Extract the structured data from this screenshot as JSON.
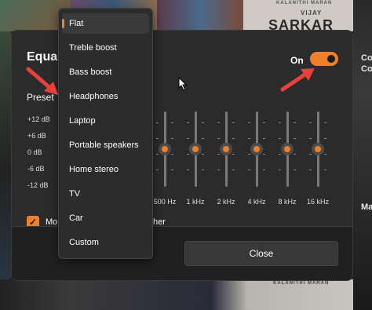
{
  "background": {
    "poster_sarkar_title": "SARKAR",
    "poster_vijay_credit": "VIJAY",
    "poster_top_credit": "KALANITHI MARAN",
    "poster_bottom_credit": "KALANITHI MARAN",
    "right_text_1": "Co",
    "right_text_2": "Co",
    "right_text_3": "Ma"
  },
  "equalizer": {
    "title": "Equal",
    "toggle_label": "On",
    "toggle_on": true,
    "preset_label": "Preset",
    "db_labels": [
      "+12 dB",
      "+6 dB",
      "0 dB",
      "-6 dB",
      "-12 dB"
    ],
    "bands": [
      {
        "label": "500 Hz",
        "gain_db": 0
      },
      {
        "label": "1 kHz",
        "gain_db": 0
      },
      {
        "label": "2 kHz",
        "gain_db": 0
      },
      {
        "label": "4 kHz",
        "gain_db": 0
      },
      {
        "label": "8 kHz",
        "gain_db": 0
      },
      {
        "label": "16 kHz",
        "gain_db": 0
      }
    ],
    "checkbox_checked": true,
    "checkbox_text_left": "Mo",
    "checkbox_text_right": "her",
    "close_label": "Close"
  },
  "preset_menu": {
    "selected": "Flat",
    "items": [
      "Flat",
      "Treble boost",
      "Bass boost",
      "Headphones",
      "Laptop",
      "Portable speakers",
      "Home stereo",
      "TV",
      "Car",
      "Custom"
    ]
  },
  "colors": {
    "accent": "#f07f2a",
    "annotation_arrow": "#e8403a",
    "dialog_bg": "#2b2b2b",
    "menu_bg": "#2c2c2c"
  },
  "icons": [
    "checkmark-icon",
    "annotation-arrow",
    "mouse-pointer-icon"
  ]
}
